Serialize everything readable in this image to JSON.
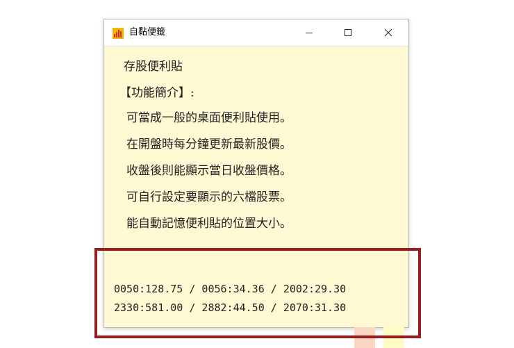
{
  "window": {
    "title": "自黏便籤",
    "controls": {
      "minimize": "minimize",
      "maximize": "maximize",
      "close": "close"
    }
  },
  "note": {
    "title": "存股便利貼",
    "section_heading": "【功能簡介】:",
    "features": [
      "可當成一般的桌面便利貼使用。",
      "在開盤時每分鐘更新最新股價。",
      "收盤後則能顯示當日收盤價格。",
      "可自行設定要顯示的六檔股票。",
      "能自動記憶便利貼的位置大小。"
    ],
    "quotes": [
      "0050:128.75 / 0056:34.36 / 2002:29.30",
      "2330:581.00 / 2882:44.50 / 2070:31.30"
    ]
  },
  "colors": {
    "note_background": "#fef9d2",
    "swatch_1": "#fbd6c3",
    "swatch_2": "#fefcc4",
    "highlight_border": "#9b1c1c"
  },
  "icons": {
    "app": "bar-chart-icon",
    "minimize": "minimize-icon",
    "maximize": "maximize-icon",
    "close": "close-icon"
  }
}
